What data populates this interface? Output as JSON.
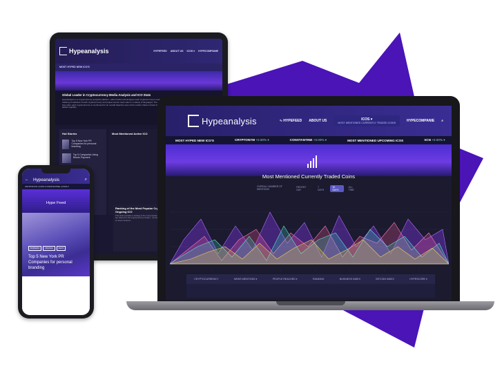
{
  "colors": {
    "accent_purple": "#4a14b7",
    "dark_bg": "#1b1a2f",
    "header": "#2f2773"
  },
  "brand": {
    "logo": "Hypeanalysis"
  },
  "tablet": {
    "nav": [
      "HYPEFEED",
      "ABOUT US",
      "ICOS ▾",
      "HYPECOMPANIE"
    ],
    "section_label": "MOST HYPED NEW ICO'S",
    "intro_title": "Global Leader in Cryptocurrency Media Analysis and ICO Stats",
    "intro_text": "Hypeanalysis is a cryptocurrency analytics platform, which tracks and analyses each cryptocurrency's media presence and sentiment. This is achieved through the tracking of websites of each cryptocurrency and project across news sites in a variety of languages. The aim is to show the market sentiment through the tracking of how often each cryptocurrency is mentioned for an overall objective view of the market. Data is shown for each coin, coin hype rankings and ICO stats, with more being added regularly.",
    "hot_stories": "Hot Stories",
    "hot_items": [
      "Top 5 New York PR Companies for personal branding",
      "Top 5 Companies Using Bitcoin Payment"
    ],
    "most_mentioned": "Most Mentioned Active ICO",
    "bottom_title": "Ranking of the Most Popular Crypto... Ongoing ICO",
    "bottom_text": "This chart provides a ranking of the most popular... tweets are offered on the cryptocurrency market... as the number of news mentions..."
  },
  "laptop": {
    "nav_hypefeed": "HYPEFEED",
    "nav_about": "ABOUT US",
    "nav_icos": "ICOS ▾",
    "nav_icos_sub": "MOST MENTIONED CURRENTLY TRADED COINS",
    "nav_hypecompanies": "HYPECOMPANIE",
    "ticker": [
      {
        "label": "MOST HYPED NEW ICO'S",
        "sub": ""
      },
      {
        "label": "CRYPTONYM ",
        "sub": "+0.00% ▾"
      },
      {
        "label": "CONSTANTINE ",
        "sub": "+0.00% ▾"
      },
      {
        "label": "MOST MENTIONED UPCOMING ICOS",
        "sub": ""
      },
      {
        "label": "XCN ",
        "sub": "+0.00% ▾"
      }
    ],
    "chart_title": "Most Mentioned Currently Traded Coins",
    "chart_sublabel": "OVERALL NUMBER OF MENTIONS",
    "range_buttons": [
      "RECENT DAY",
      "7 DAYS",
      "30 DAYS",
      "ALL TIME"
    ],
    "range_selected": "30 DAYS",
    "table_headers": [
      "CRYPTOCURRENCY",
      "NEWS MENTIONS ▾",
      "PEOPLE REACHED ▾",
      "RANKING",
      "BUSINESS INDEX",
      "BITCOIN INDEX",
      "HYPESCORE ▾"
    ]
  },
  "phone": {
    "ticker": "CRYPTONYM +0.00% ▾   CONSTANTINE +0.00% ▾",
    "hype_feed": "Hype Feed",
    "tags": [
      "BUSINESS",
      "FINANCE",
      "NEWS"
    ],
    "article_title": "Top 5 New York PR Companies for personal branding"
  }
}
